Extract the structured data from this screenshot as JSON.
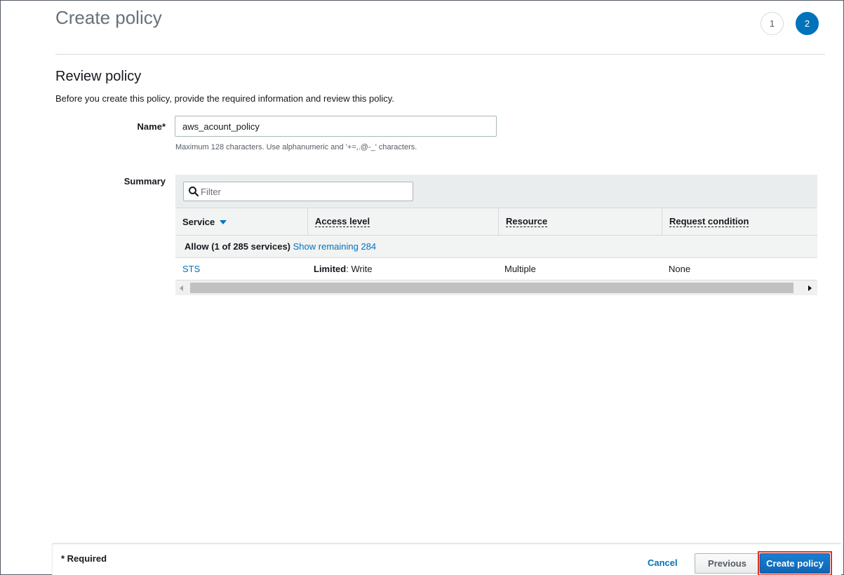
{
  "page": {
    "title": "Create policy",
    "steps": [
      "1",
      "2"
    ],
    "active_step": "2"
  },
  "review": {
    "heading": "Review policy",
    "description": "Before you create this policy, provide the required information and review this policy."
  },
  "name_field": {
    "label": "Name*",
    "value": "aws_acount_policy",
    "hint": "Maximum 128 characters. Use alphanumeric and '+=,.@-_' characters."
  },
  "summary": {
    "label": "Summary",
    "filter_placeholder": "Filter",
    "columns": [
      "Service",
      "Access level",
      "Resource",
      "Request condition"
    ],
    "group": {
      "label": "Allow (1 of 285 services)",
      "link": "Show remaining 284"
    },
    "rows": [
      {
        "service": "STS",
        "access_bold": "Limited",
        "access_rest": ": Write",
        "resource": "Multiple",
        "condition": "None"
      }
    ],
    "scroll_position": 0
  },
  "footer": {
    "required_note": "* Required",
    "cancel_label": "Cancel",
    "previous_label": "Previous",
    "create_label": "Create policy"
  },
  "colors": {
    "accent": "#0073bb",
    "highlight_outline": "#e0322b"
  }
}
